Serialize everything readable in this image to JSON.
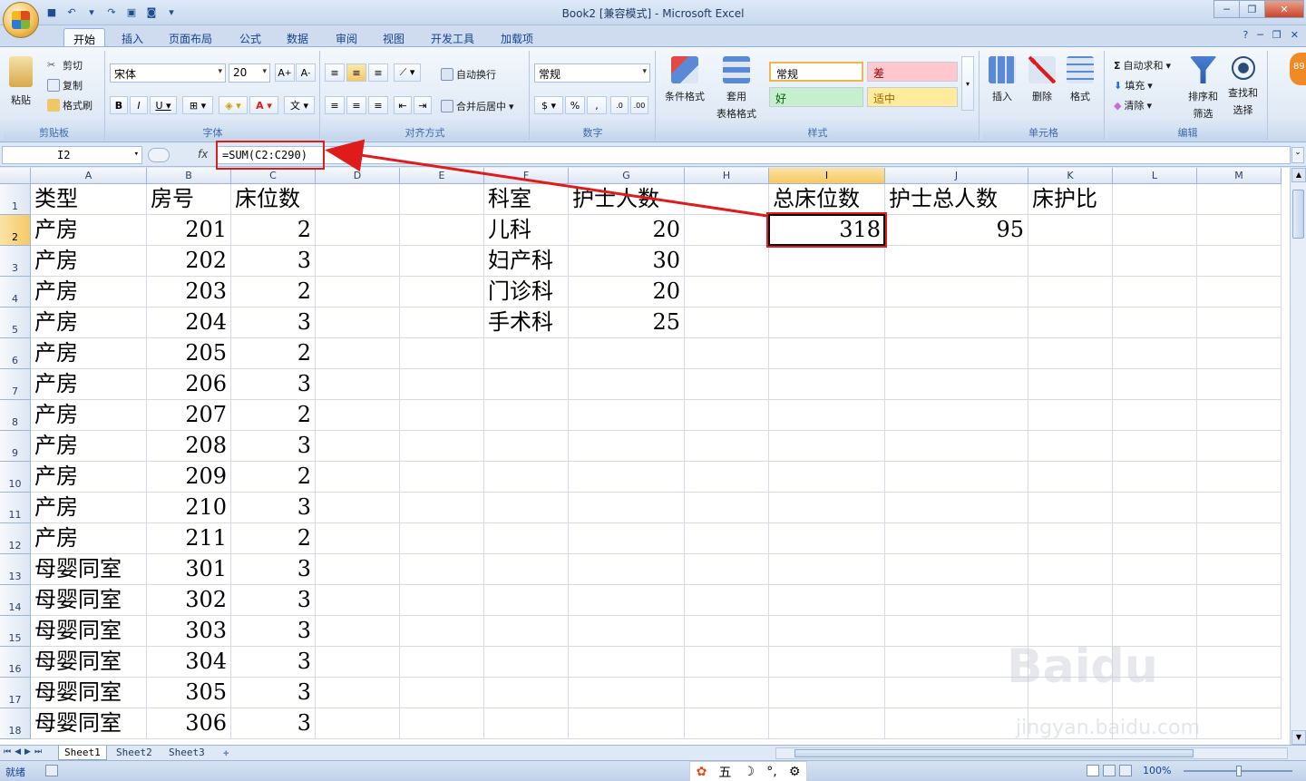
{
  "window": {
    "title": "Book2  [兼容模式] - Microsoft Excel"
  },
  "ribbon_tabs": [
    "开始",
    "插入",
    "页面布局",
    "公式",
    "数据",
    "审阅",
    "视图",
    "开发工具",
    "加载项"
  ],
  "clipboard": {
    "paste": "粘贴",
    "cut": "剪切",
    "copy": "复制",
    "format_painter": "格式刷",
    "group": "剪贴板"
  },
  "font": {
    "name": "宋体",
    "size": "20",
    "group": "字体"
  },
  "alignment": {
    "wrap": "自动换行",
    "merge": "合并后居中",
    "group": "对齐方式"
  },
  "number": {
    "format": "常规",
    "percent": "%",
    "comma": ",",
    "group": "数字"
  },
  "styles": {
    "conditional": "条件格式",
    "table_1": "套用",
    "table_2": "表格格式",
    "normal": "常规",
    "bad": "差",
    "good": "好",
    "neutral": "适中",
    "group": "样式"
  },
  "cells_group": {
    "insert": "插入",
    "delete": "删除",
    "format": "格式",
    "group": "单元格"
  },
  "editing": {
    "autosum": "自动求和",
    "fill": "填充",
    "clear": "清除",
    "sort_1": "排序和",
    "sort_2": "筛选",
    "find_1": "查找和",
    "find_2": "选择",
    "group": "编辑"
  },
  "formula_bar": {
    "name_box": "I2",
    "fx": "fx",
    "formula": "=SUM(C2:C290)"
  },
  "columns": [
    {
      "id": "A",
      "selected": false
    },
    {
      "id": "B",
      "selected": false
    },
    {
      "id": "C",
      "selected": false
    },
    {
      "id": "D",
      "selected": false
    },
    {
      "id": "E",
      "selected": false
    },
    {
      "id": "F",
      "selected": false
    },
    {
      "id": "G",
      "selected": false
    },
    {
      "id": "H",
      "selected": false
    },
    {
      "id": "I",
      "selected": true
    },
    {
      "id": "J",
      "selected": false
    },
    {
      "id": "K",
      "selected": false
    },
    {
      "id": "L",
      "selected": false
    },
    {
      "id": "M",
      "selected": false
    }
  ],
  "rows": [
    {
      "n": "1",
      "A": "类型",
      "B": "房号",
      "C": "床位数",
      "F": "科室",
      "G": "护士人数",
      "I": "总床位数",
      "J": "护士总人数",
      "K": "床护比"
    },
    {
      "n": "2",
      "A": "产房",
      "B": "201",
      "C": "2",
      "F": "儿科",
      "G": "20",
      "I": "318",
      "J": "95"
    },
    {
      "n": "3",
      "A": "产房",
      "B": "202",
      "C": "3",
      "F": "妇产科",
      "G": "30"
    },
    {
      "n": "4",
      "A": "产房",
      "B": "203",
      "C": "2",
      "F": "门诊科",
      "G": "20"
    },
    {
      "n": "5",
      "A": "产房",
      "B": "204",
      "C": "3",
      "F": "手术科",
      "G": "25"
    },
    {
      "n": "6",
      "A": "产房",
      "B": "205",
      "C": "2"
    },
    {
      "n": "7",
      "A": "产房",
      "B": "206",
      "C": "3"
    },
    {
      "n": "8",
      "A": "产房",
      "B": "207",
      "C": "2"
    },
    {
      "n": "9",
      "A": "产房",
      "B": "208",
      "C": "3"
    },
    {
      "n": "10",
      "A": "产房",
      "B": "209",
      "C": "2"
    },
    {
      "n": "11",
      "A": "产房",
      "B": "210",
      "C": "3"
    },
    {
      "n": "12",
      "A": "产房",
      "B": "211",
      "C": "2"
    },
    {
      "n": "13",
      "A": "母婴同室",
      "B": "301",
      "C": "3"
    },
    {
      "n": "14",
      "A": "母婴同室",
      "B": "302",
      "C": "3"
    },
    {
      "n": "15",
      "A": "母婴同室",
      "B": "303",
      "C": "3"
    },
    {
      "n": "16",
      "A": "母婴同室",
      "B": "304",
      "C": "3"
    },
    {
      "n": "17",
      "A": "母婴同室",
      "B": "305",
      "C": "3"
    },
    {
      "n": "18",
      "A": "母婴同室",
      "B": "306",
      "C": "3"
    }
  ],
  "sheets": [
    {
      "name": "Sheet1",
      "active": true
    },
    {
      "name": "Sheet2",
      "active": false
    },
    {
      "name": "Sheet3",
      "active": false
    }
  ],
  "status": {
    "ready": "就绪",
    "zoom": "100%",
    "ime_mode": "五"
  },
  "colors": {
    "highlight_red": "#e01b1b",
    "selected_header": "#f6c964"
  }
}
